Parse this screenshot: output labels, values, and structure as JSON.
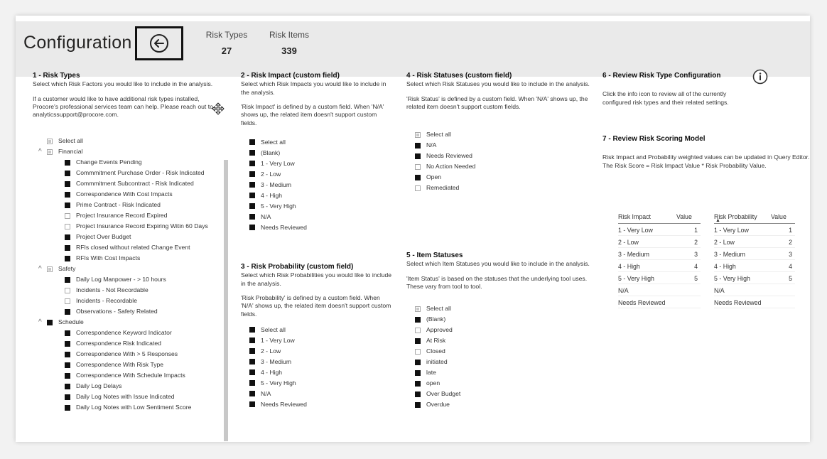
{
  "header": {
    "title": "Configuration",
    "kpis": [
      {
        "label": "Risk Types",
        "value": "27"
      },
      {
        "label": "Risk Items",
        "value": "339"
      }
    ]
  },
  "icons": {
    "back": "arrow-left-circle-icon",
    "info": "info-circle-icon",
    "move": "move-cursor-icon",
    "caret": "chevron-up-icon"
  },
  "colors": {
    "checked": "#111111",
    "topbar": "#eaeaea"
  },
  "risk_types": {
    "title": "1 - Risk Types",
    "desc": [
      "Select which Risk Factors you would like to include in the analysis.",
      "If a customer would like to have additional risk types installed, Procore's professional services team can help. Please reach out to analyticssupport@procore.com."
    ],
    "select_all": "Select all",
    "groups": [
      {
        "label": "Financial",
        "items": [
          "Change Events Pending",
          "Commmitment Purchase Order - Risk Indicated",
          "Commmitment Subcontract - Risk Indicated",
          "Correspondence With Cost Impacts",
          "Prime Contract - Risk Indicated",
          "Project Insurance Record Expired",
          "Project Insurance Record Expiring Witin 60 Days",
          "Project Over Budget",
          "RFIs closed without related Change Event",
          "RFIs With Cost Impacts"
        ]
      },
      {
        "label": "Safety",
        "items": [
          "Daily Log Manpower - > 10 hours",
          "Incidents - Not Recordable",
          "Incidents - Recordable",
          "Observations - Safety Related"
        ]
      },
      {
        "label": "Schedule",
        "items": [
          "Correspondence Keyword Indicator",
          "Correspondence Risk Indicated",
          "Correspondence With > 5 Responses",
          "Correspondence With Risk Type",
          "Correspondence With Schedule Impacts",
          "Daily Log Delays",
          "Daily Log Notes with Issue Indicated",
          "Daily Log Notes with Low Sentiment Score"
        ]
      }
    ]
  },
  "risk_impact": {
    "title": "2 - Risk Impact (custom field)",
    "desc": [
      "Select which Risk Impacts you would like to include in the analysis.",
      "'Risk Impact' is defined by a custom field. When 'N/A' shows up, the related item doesn't support custom fields."
    ],
    "items": [
      "Select all",
      "(Blank)",
      "1 - Very Low",
      "2 - Low",
      "3 - Medium",
      "4 - High",
      "5 - Very High",
      "N/A",
      "Needs Reviewed"
    ]
  },
  "risk_probability": {
    "title": "3 - Risk Probability (custom field)",
    "desc": [
      "Select which Risk Probabilities you would like to include in the analysis.",
      "'Risk Probability' is defined by a custom field. When 'N/A' shows up, the related item doesn't support custom fields."
    ],
    "items": [
      "Select all",
      "1 - Very Low",
      "2 - Low",
      "3 - Medium",
      "4 - High",
      "5 - Very High",
      "N/A",
      "Needs Reviewed"
    ]
  },
  "risk_statuses": {
    "title": "4 - Risk Statuses (custom field)",
    "desc": [
      "Select which Risk Statuses you would like to include in the analysis.",
      "'Risk Status' is defined by a custom field. When 'N/A' shows up, the related item doesn't support custom fields."
    ],
    "items": [
      "Select all",
      "N/A",
      "Needs Reviewed",
      "No Action Needed",
      "Open",
      "Remediated"
    ]
  },
  "item_statuses": {
    "title": "5 - Item Statuses",
    "desc": [
      "Select which Item Statuses you would like to include in the analysis.",
      "'Item Status' is based on the statuses that the underlying tool uses. These vary from tool to tool."
    ],
    "items": [
      "Select all",
      "(Blank)",
      "Approved",
      "At Risk",
      "Closed",
      "initiated",
      "late",
      "open",
      "Over Budget",
      "Overdue"
    ]
  },
  "review_config": {
    "title": "6 - Review Risk Type Configuration",
    "desc": "Click the info icon to review all of the currently configured risk types and their related settings."
  },
  "scoring": {
    "title": "7 - Review Risk Scoring Model",
    "desc": "Risk Impact and Probability weighted values can be updated in Query Editor. The Risk Score = Risk Impact Value * Risk Probability Value.",
    "impact_table": {
      "headers": [
        "Risk Impact",
        "Value"
      ],
      "rows": [
        [
          "1 - Very Low",
          "1"
        ],
        [
          "2 - Low",
          "2"
        ],
        [
          "3 - Medium",
          "3"
        ],
        [
          "4 - High",
          "4"
        ],
        [
          "5 - Very High",
          "5"
        ],
        [
          "N/A",
          ""
        ],
        [
          "Needs Reviewed",
          ""
        ]
      ]
    },
    "probability_table": {
      "headers": [
        "Risk Probability",
        "Value"
      ],
      "rows": [
        [
          "1 - Very Low",
          "1"
        ],
        [
          "2 - Low",
          "2"
        ],
        [
          "3 - Medium",
          "3"
        ],
        [
          "4 - High",
          "4"
        ],
        [
          "5 - Very High",
          "5"
        ],
        [
          "N/A",
          ""
        ],
        [
          "Needs Reviewed",
          ""
        ]
      ]
    }
  }
}
